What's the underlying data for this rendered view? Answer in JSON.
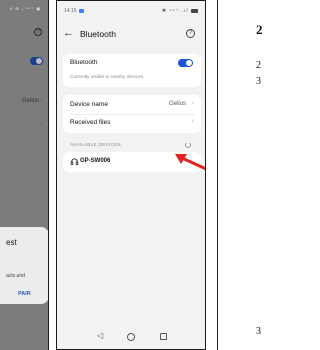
{
  "left_phone": {
    "status_text": "0 ⊕ ᵻ ⁴⁶⁺ ▣",
    "help_icon": "?",
    "device_name_value": "Gelius",
    "dialog": {
      "title": "est",
      "body": "acts and",
      "pair_button": "PAIR"
    }
  },
  "status_bar": {
    "time": "14:15",
    "icons": "✱ ⁴⁶⁺ .ıl"
  },
  "header": {
    "back_glyph": "←",
    "title": "Bluetooth",
    "help_glyph": "?"
  },
  "bluetooth": {
    "label": "Bluetooth",
    "caption": "Currently visible to nearby devices.",
    "enabled": true
  },
  "device_card": {
    "device_name_label": "Device name",
    "device_name_value": "Gelius",
    "received_files_label": "Received files",
    "chevron": "›"
  },
  "available": {
    "section_title": "AVAILABLE DEVICES",
    "items": [
      {
        "name": "GP-SW006",
        "icon": "headset-icon"
      }
    ]
  },
  "annotation": {
    "arrow_color": "#e52222"
  },
  "nav": {
    "back": "◁"
  },
  "document": {
    "heading": "2",
    "lines": [
      "2",
      "3"
    ],
    "bottom_line": "3"
  }
}
